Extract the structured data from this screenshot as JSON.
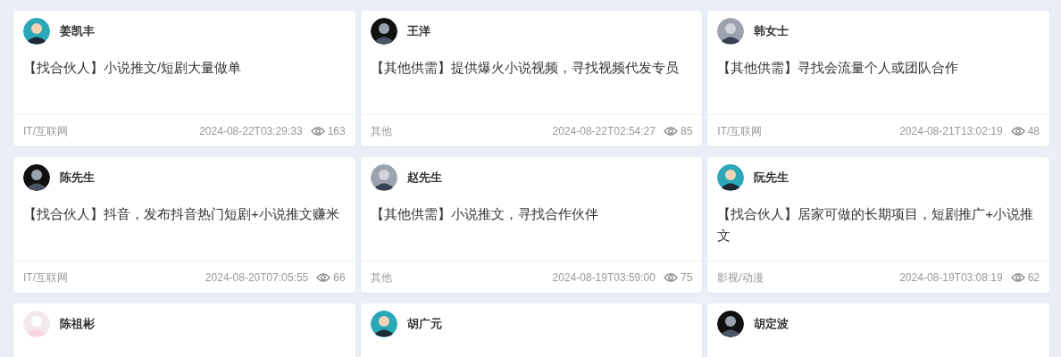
{
  "posts": [
    {
      "author": "姜凯丰",
      "avatar": {
        "kind": "teal"
      },
      "title": "【找合伙人】小说推文/短剧大量做单",
      "category": "IT/互联网",
      "time": "2024-08-22T03:29:33",
      "views": "163"
    },
    {
      "author": "王洋",
      "avatar": {
        "kind": "dark"
      },
      "title": "【其他供需】提供爆火小说视频，寻找视频代发专员",
      "category": "其他",
      "time": "2024-08-22T02:54:27",
      "views": "85"
    },
    {
      "author": "韩女士",
      "avatar": {
        "kind": "gray"
      },
      "title": "【其他供需】寻找会流量个人或团队合作",
      "category": "IT/互联网",
      "time": "2024-08-21T13:02:19",
      "views": "48"
    },
    {
      "author": "陈先生",
      "avatar": {
        "kind": "dark"
      },
      "title": "【找合伙人】抖音，发布抖音热门短剧+小说推文赚米",
      "category": "IT/互联网",
      "time": "2024-08-20T07:05:55",
      "views": "66"
    },
    {
      "author": "赵先生",
      "avatar": {
        "kind": "gray"
      },
      "title": "【其他供需】小说推文，寻找合作伙伴",
      "category": "其他",
      "time": "2024-08-19T03:59:00",
      "views": "75"
    },
    {
      "author": "阮先生",
      "avatar": {
        "kind": "teal"
      },
      "title": "【找合伙人】居家可做的长期项目，短剧推广+小说推文",
      "category": "影视/动漫",
      "time": "2024-08-19T03:08:19",
      "views": "62"
    },
    {
      "author": "陈祖彬",
      "avatar": {
        "kind": "light"
      }
    },
    {
      "author": "胡广元",
      "avatar": {
        "kind": "teal"
      }
    },
    {
      "author": "胡定波",
      "avatar": {
        "kind": "dark"
      }
    }
  ]
}
